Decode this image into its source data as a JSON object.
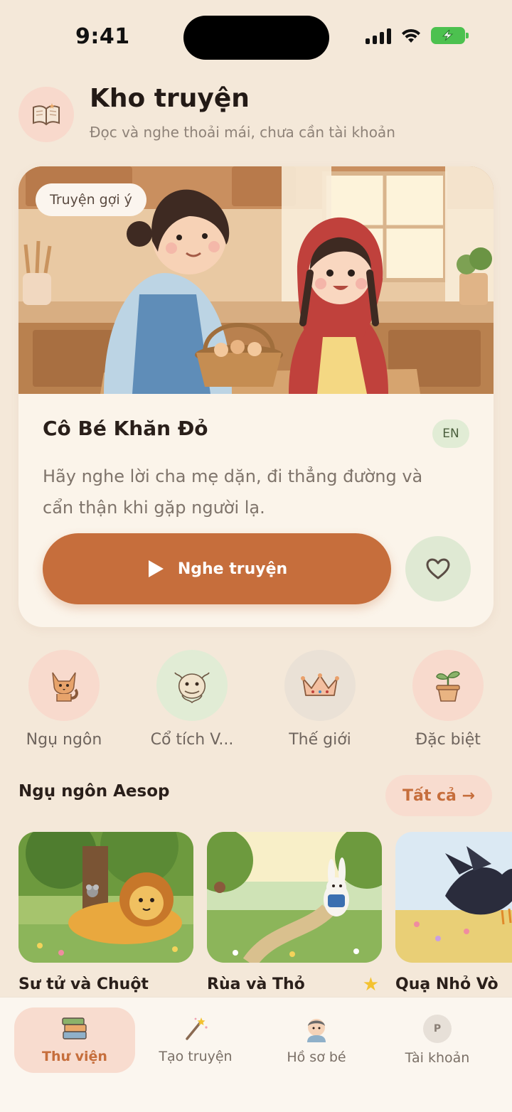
{
  "status_bar": {
    "time": "9:41"
  },
  "header": {
    "title": "Kho truyện",
    "subtitle": "Đọc và nghe thoải mái, chưa cần tài khoản",
    "icon": "open-book-icon"
  },
  "featured": {
    "badge": "Truyện gợi ý",
    "title": "Cô Bé Khăn Đỏ",
    "language": "EN",
    "description": "Hãy nghe lời cha mẹ dặn, đi thẳng đường và cẩn thận khi gặp người lạ.",
    "listen_label": "Nghe truyện",
    "liked": false
  },
  "categories": [
    {
      "label": "Ngụ ngôn",
      "icon": "fox-icon",
      "color": "#f8dacd"
    },
    {
      "label": "Cổ tích V...",
      "icon": "dragon-icon",
      "color": "#e1ecd5"
    },
    {
      "label": "Thế giới",
      "icon": "crown-icon",
      "color": "#eae1d6"
    },
    {
      "label": "Đặc biệt",
      "icon": "sprout-icon",
      "color": "#f8dacd"
    }
  ],
  "section": {
    "title": "Ngụ ngôn Aesop",
    "see_all": "Tất cả →"
  },
  "stories": [
    {
      "title": "Sư tử và Chuột",
      "starred": false
    },
    {
      "title": "Rùa và Thỏ",
      "starred": true
    },
    {
      "title": "Quạ Nhỏ Vò",
      "starred": false
    }
  ],
  "bottom_nav": [
    {
      "label": "Thư viện",
      "icon": "books-icon",
      "active": true
    },
    {
      "label": "Tạo truyện",
      "icon": "magic-wand-icon",
      "active": false
    },
    {
      "label": "Hồ sơ bé",
      "icon": "child-avatar-icon",
      "active": false
    },
    {
      "label": "Tài khoản",
      "icon": "account-avatar-icon",
      "avatar_letter": "P",
      "active": false
    }
  ],
  "colors": {
    "background": "#f4e8d9",
    "accent": "#c66e3c",
    "card": "#fbf4ea",
    "green_soft": "#e1ecd5",
    "peach_soft": "#f8dccf"
  }
}
